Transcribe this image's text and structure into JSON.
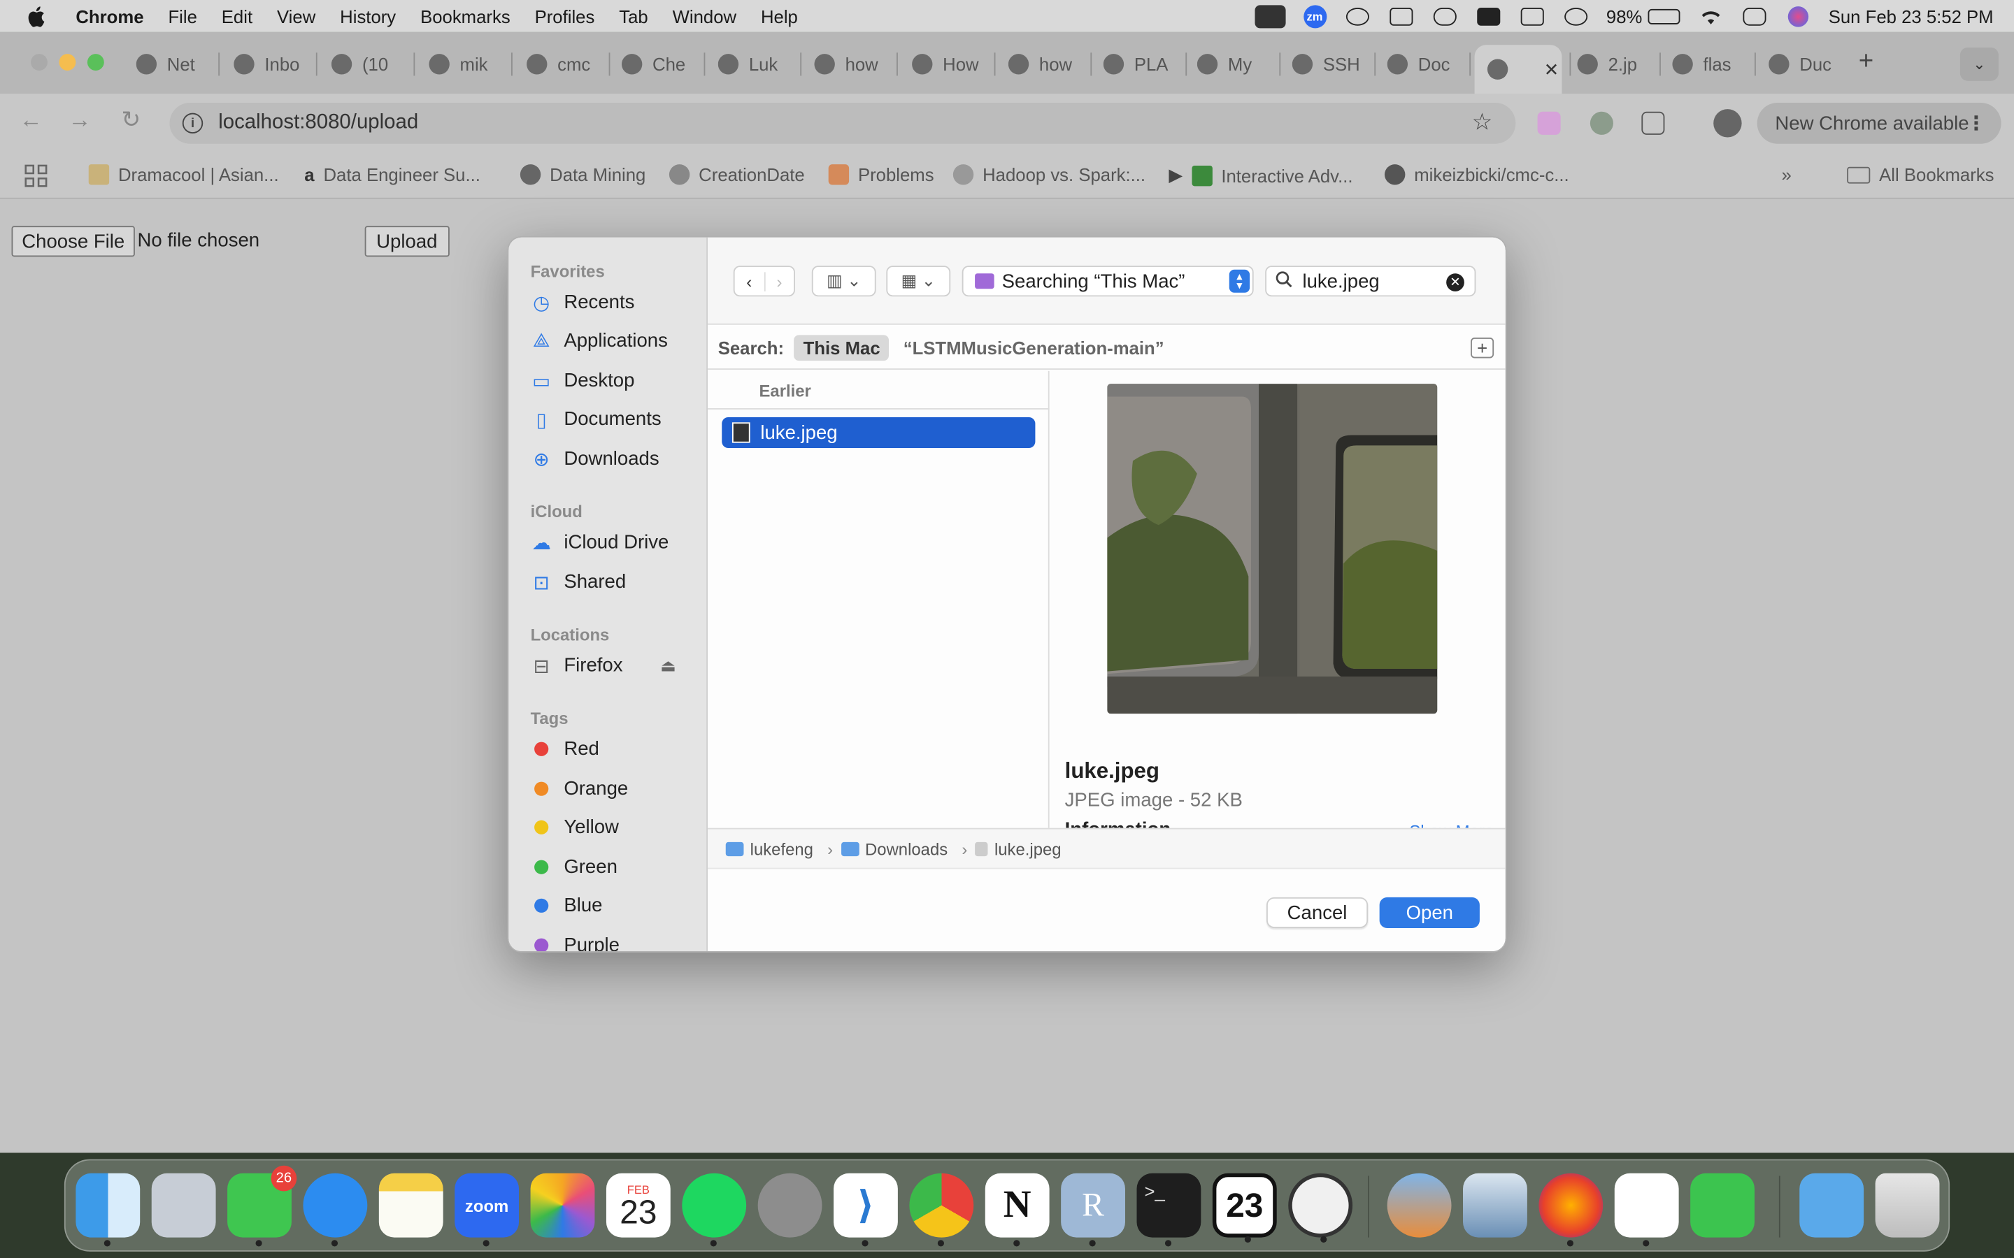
{
  "menubar": {
    "app": "Chrome",
    "items": [
      "File",
      "Edit",
      "View",
      "History",
      "Bookmarks",
      "Profiles",
      "Tab",
      "Window",
      "Help"
    ],
    "battery": "98%",
    "datetime": "Sun Feb 23  5:52 PM"
  },
  "tabs": [
    {
      "label": "Net",
      "icon": "netflix-icon"
    },
    {
      "label": "Inbo",
      "icon": "gmail-icon"
    },
    {
      "label": "(10",
      "icon": "youtube-icon"
    },
    {
      "label": "mik",
      "icon": "github-icon"
    },
    {
      "label": "cmc",
      "icon": "github-icon"
    },
    {
      "label": "Che",
      "icon": "chatgpt-icon"
    },
    {
      "label": "Luk",
      "icon": "github-icon"
    },
    {
      "label": "how",
      "icon": "google-icon"
    },
    {
      "label": "How",
      "icon": "stackoverflow-icon"
    },
    {
      "label": "how",
      "icon": "google-icon"
    },
    {
      "label": "PLA",
      "icon": "gmail-icon"
    },
    {
      "label": "My",
      "icon": "globe-icon"
    },
    {
      "label": "SSH",
      "icon": "chatgpt-icon"
    },
    {
      "label": "Doc",
      "icon": "docs-icon"
    },
    {
      "label": "",
      "icon": "globe-icon",
      "active": true
    },
    {
      "label": "2.jp",
      "icon": "globe-icon"
    },
    {
      "label": "flas",
      "icon": "github-icon"
    },
    {
      "label": "Duc",
      "icon": "globe-icon"
    }
  ],
  "toolbar": {
    "url": "localhost:8080/upload",
    "update_label": "New Chrome available"
  },
  "bookmarks": [
    {
      "label": "Dramacool | Asian..."
    },
    {
      "label": "Data Engineer Su..."
    },
    {
      "label": "Data Mining"
    },
    {
      "label": "CreationDate"
    },
    {
      "label": "Problems"
    },
    {
      "label": "Hadoop vs. Spark:..."
    },
    {
      "label": "Interactive Adv..."
    },
    {
      "label": "mikeizbicki/cmc-c..."
    }
  ],
  "all_bookmarks": "All Bookmarks",
  "page": {
    "choose_file": "Choose File",
    "no_file": "No file chosen",
    "upload": "Upload"
  },
  "dialog": {
    "sidebar": {
      "favorites_header": "Favorites",
      "favorites": [
        "Recents",
        "Applications",
        "Desktop",
        "Documents",
        "Downloads"
      ],
      "icloud_header": "iCloud",
      "icloud": [
        "iCloud Drive",
        "Shared"
      ],
      "locations_header": "Locations",
      "locations": [
        "Firefox"
      ],
      "tags_header": "Tags",
      "tags": [
        {
          "label": "Red",
          "color": "#e8413a"
        },
        {
          "label": "Orange",
          "color": "#f08a24"
        },
        {
          "label": "Yellow",
          "color": "#f0c419"
        },
        {
          "label": "Green",
          "color": "#3cb94a"
        },
        {
          "label": "Blue",
          "color": "#2f7ae5"
        },
        {
          "label": "Purple",
          "color": "#9b59d0"
        }
      ]
    },
    "location": "Searching “This Mac”",
    "search_value": "luke.jpeg",
    "scope": {
      "label": "Search:",
      "selected": "This Mac",
      "alternative": "“LSTMMusicGeneration-main”"
    },
    "list_header": "Earlier",
    "selected_file": "luke.jpeg",
    "preview": {
      "name": "luke.jpeg",
      "meta": "JPEG image - 52 KB",
      "info_header": "Information",
      "show_more": "Show More"
    },
    "path": [
      "lukefeng",
      "Downloads",
      "luke.jpeg"
    ],
    "cancel": "Cancel",
    "open": "Open"
  },
  "dock": {
    "messages_badge": "26",
    "calendar_month": "FEB",
    "calendar_day": "23",
    "apps": [
      "finder-icon",
      "launchpad-icon",
      "messages-icon",
      "safari-icon",
      "notes-icon",
      "zoom-icon",
      "photos-icon",
      "calendar-icon",
      "spotify-icon",
      "system-settings-icon",
      "vscode-icon",
      "chrome-icon",
      "notion-icon",
      "r-icon",
      "terminal-icon",
      "calendar-23-icon",
      "activity-icon",
      "preview-icon",
      "photo-app-icon",
      "firefox-icon",
      "slack-icon",
      "facetime-icon",
      "folder-icon",
      "trash-icon"
    ]
  },
  "colors": {
    "accent": "#2f7ae5",
    "selection": "#1f5fd0"
  }
}
